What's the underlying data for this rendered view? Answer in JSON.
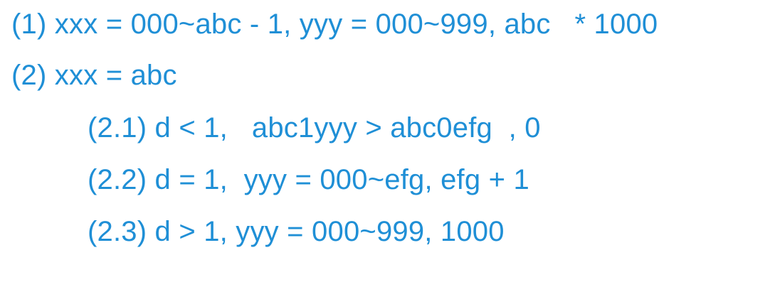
{
  "lines": [
    "(1) xxx = 000~abc - 1, yyy = 000~999, abc   * 1000",
    "(2) xxx = abc",
    "(2.1) d < 1,   abc1yyy > abc0efg  , 0",
    "(2.2) d = 1,  yyy = 000~efg, efg + 1",
    "(2.3) d > 1, yyy = 000~999, 1000"
  ],
  "colors": {
    "text": "#1f8fd6",
    "background": "#ffffff"
  }
}
